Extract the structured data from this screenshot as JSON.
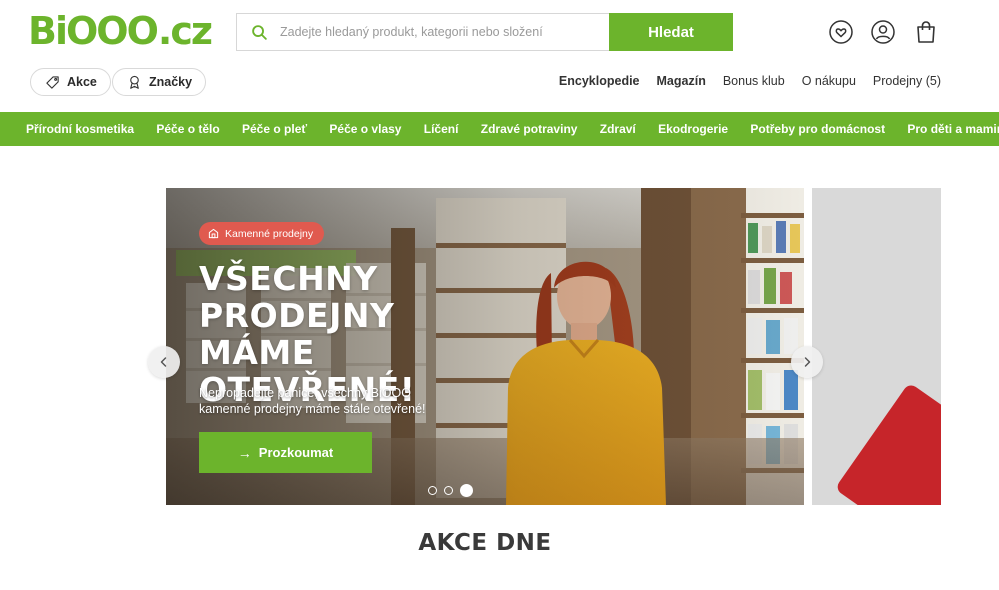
{
  "brand": {
    "logo_main": "BiOOO",
    "logo_tld": ".cz",
    "accent": "#6cb42c"
  },
  "search": {
    "placeholder": "Zadejte hledaný produkt, kategorii nebo složení",
    "button_label": "Hledat"
  },
  "header_icons": [
    "heart-icon",
    "user-icon",
    "shopping-bag-icon"
  ],
  "quick_links": [
    {
      "label": "Akce",
      "icon": "tag-icon"
    },
    {
      "label": "Značky",
      "icon": "award-icon"
    }
  ],
  "top_links": [
    {
      "label": "Encyklopedie",
      "bold": true
    },
    {
      "label": "Magazín",
      "bold": true
    },
    {
      "label": "Bonus klub",
      "bold": false
    },
    {
      "label": "O nákupu",
      "bold": false
    },
    {
      "label": "Prodejny (5)",
      "bold": false
    }
  ],
  "categories": [
    "Přírodní kosmetika",
    "Péče o tělo",
    "Péče o pleť",
    "Péče o vlasy",
    "Líčení",
    "Zdravé potraviny",
    "Zdraví",
    "Ekodrogerie",
    "Potřeby pro domácnost",
    "Pro děti a maminky"
  ],
  "hero": {
    "badge": "Kamenné prodejny",
    "title": "Všechny prodejny máme otevřené!",
    "text": "Nepropadejte panice, všechny BiOOO kamenné prodejny máme stále otevřené!",
    "cta": "Prozkoumat",
    "slides_total": 3,
    "active_slide": 3
  },
  "section": {
    "title": "AKCE DNE"
  }
}
